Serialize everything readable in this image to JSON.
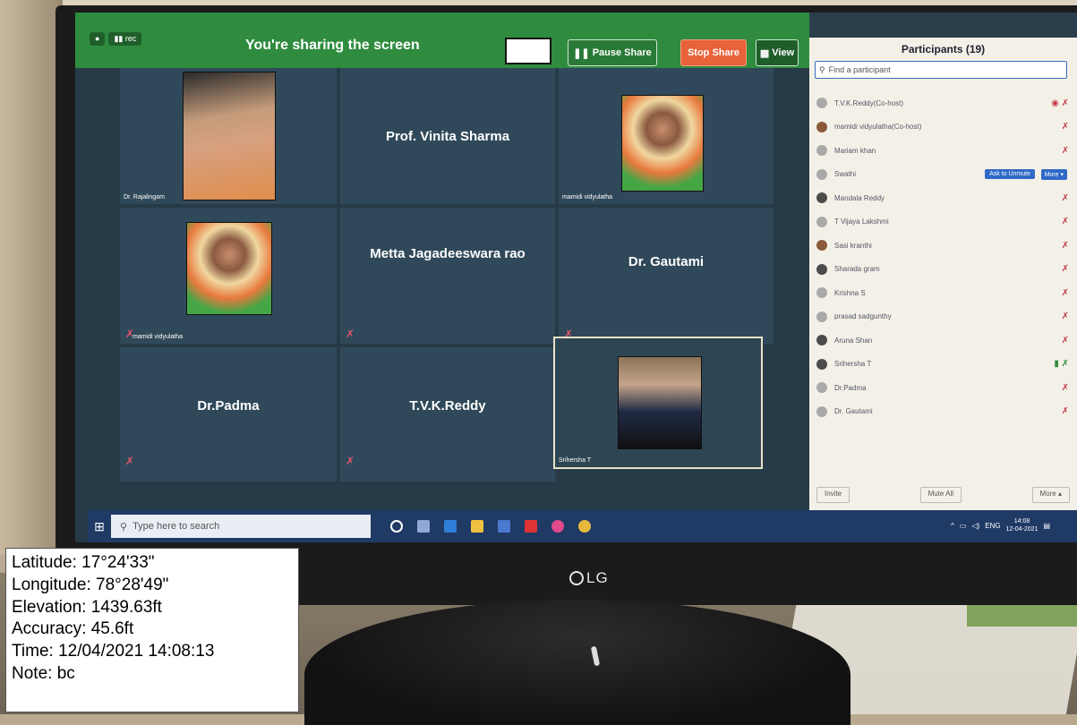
{
  "share_bar": {
    "btn_a": "●",
    "btn_b": "▮▮ rec",
    "title": "You're sharing the screen",
    "pause_label": "Pause Share",
    "stop_label": "Stop Share",
    "view_label": "View"
  },
  "tiles": [
    {
      "name": "Dr. Rajalingam",
      "type": "video"
    },
    {
      "name": "Prof. Vinita Sharma",
      "type": "text"
    },
    {
      "name": "mamidi vidyulatha",
      "type": "video"
    },
    {
      "name": "mamidi vidyulatha",
      "type": "video"
    },
    {
      "name": "Metta Jagadeeswara rao",
      "type": "text"
    },
    {
      "name": "Dr. Gautami",
      "type": "text"
    },
    {
      "name": "Dr.Padma",
      "type": "text"
    },
    {
      "name": "T.V.K.Reddy",
      "type": "text"
    },
    {
      "name": "Srihersha T",
      "type": "video"
    }
  ],
  "participants": {
    "title": "Participants (19)",
    "search_placeholder": "Find a participant",
    "rows": [
      {
        "name": "T.V.K.Reddy(Co-host)"
      },
      {
        "name": "mamidi vidyulatha(Co-host)"
      },
      {
        "name": "Mariam khan"
      },
      {
        "name": "Swathi"
      },
      {
        "name": "Mandala Reddy"
      },
      {
        "name": "T Vijaya Lakshmi"
      },
      {
        "name": "Sasi kranthi"
      },
      {
        "name": "Sharada gram"
      },
      {
        "name": "Krishna S"
      },
      {
        "name": "prasad sadgunthy"
      },
      {
        "name": "Aruna Shan"
      },
      {
        "name": "Srihersha T"
      },
      {
        "name": "Dr.Padma"
      },
      {
        "name": "Dr. Gautami"
      }
    ],
    "ask_unmute": "Ask to Unmute",
    "more": "More ▾",
    "footer_invite": "Invite",
    "footer_mute": "Mute All",
    "footer_more": "More ▴"
  },
  "taskbar": {
    "search_placeholder": "Type here to search",
    "tray_lang": "ENG",
    "time": "14:08",
    "date": "12-04-2021"
  },
  "monitor_brand": "LG",
  "gps": {
    "latitude": "Latitude: 17°24'33\"",
    "longitude": "Longitude: 78°28'49\"",
    "elevation": "Elevation: 1439.63ft",
    "accuracy": "Accuracy: 45.6ft",
    "time": "Time: 12/04/2021 14:08:13",
    "note": "Note: bc"
  }
}
